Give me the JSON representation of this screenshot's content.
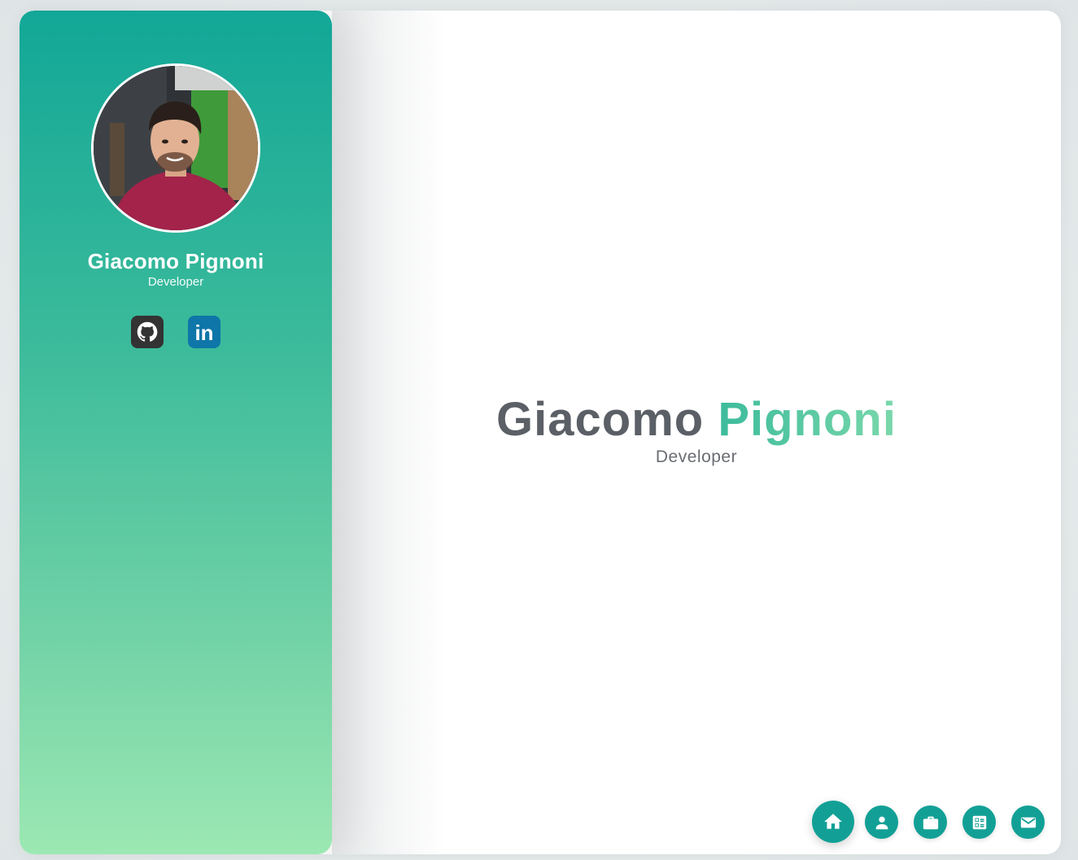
{
  "sidebar": {
    "name": "Giacomo Pignoni",
    "role": "Developer",
    "social": [
      {
        "icon": "github-icon",
        "label": "GitHub"
      },
      {
        "icon": "linkedin-icon",
        "label": "in"
      }
    ]
  },
  "hero": {
    "first_name": "Giacomo",
    "last_name": "Pignoni",
    "role": "Developer"
  },
  "nav": [
    {
      "icon": "home-icon",
      "active": true
    },
    {
      "icon": "person-icon",
      "active": false
    },
    {
      "icon": "briefcase-icon",
      "active": false
    },
    {
      "icon": "resume-icon",
      "active": false
    },
    {
      "icon": "mail-icon",
      "active": false
    }
  ],
  "colors": {
    "accent": "#12a096",
    "gradient_top": "#12a797",
    "gradient_bottom": "#9ce8b3",
    "github": "#333333",
    "linkedin": "#0e76a8",
    "hero_text": "#5b5f66"
  }
}
